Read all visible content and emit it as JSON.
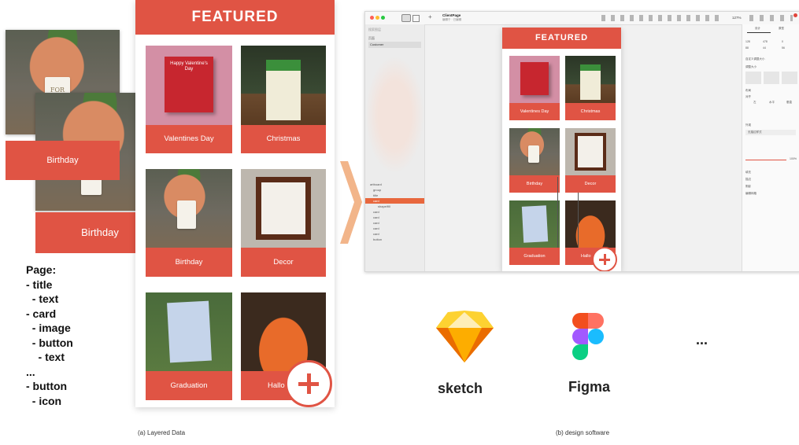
{
  "layered": {
    "featured_title": "FEATURED",
    "cards": [
      {
        "label": "Valentines Day"
      },
      {
        "label": "Christmas"
      },
      {
        "label": "Birthday"
      },
      {
        "label": "Decor"
      },
      {
        "label": "Graduation"
      },
      {
        "label": "Hallo"
      }
    ],
    "card_text_art": {
      "valentine": "Happy Valentine's Day"
    },
    "tag_text": "FOR YOU",
    "exploded_button_label": "Birthday",
    "exploded_card_label": "Birthday",
    "tree": [
      "Page:",
      "- title",
      "  - text",
      "- card",
      "  - image",
      "  - button",
      "    - text",
      "...",
      "- button",
      "  - icon"
    ],
    "caption": "(a) Layered Data"
  },
  "software": {
    "window_title": "ClientPage",
    "window_subtitle": "编辑于 · 已编辑",
    "zoom": "127%",
    "left_panel": {
      "search_placeholder": "搜索图层",
      "page_section": "页面",
      "page_item": "Customer",
      "layers": [
        "artboard",
        "group",
        "title",
        "card",
        "shape/fill",
        "card",
        "card",
        "card",
        "card",
        "card",
        "button"
      ]
    },
    "right_panel": {
      "tabs": [
        "设计",
        "原型"
      ],
      "fields": [
        "128",
        "478",
        "0",
        "88",
        "44",
        "56"
      ],
      "section_labels": [
        "自定义调整大小",
        "调整大小",
        "布局",
        "对齐",
        "外观",
        "填充",
        "描边",
        "阴影",
        "编辑网格"
      ],
      "align_options": [
        "左",
        "水平",
        "垂直"
      ],
      "input_placeholder": "无描边样式",
      "opacity": "100%"
    },
    "featured_title": "FEATURED",
    "cards": [
      {
        "label": "Valentines Day"
      },
      {
        "label": "Christmas"
      },
      {
        "label": "Birthday"
      },
      {
        "label": "Decor"
      },
      {
        "label": "Graduation"
      },
      {
        "label": "Hallo"
      }
    ],
    "caption": "(b) design software",
    "tools": [
      {
        "name": "sketch"
      },
      {
        "name": "Figma"
      },
      {
        "name": "..."
      }
    ]
  },
  "colors": {
    "accent": "#e05444",
    "arrow": "#f2b58a",
    "selection": "#e8673d",
    "sketch_top": "#fdd231",
    "sketch_bottom": "#f7a21b",
    "figma_red": "#f24e1e",
    "figma_orange": "#ff7262",
    "figma_purple": "#a259ff",
    "figma_blue": "#1abcfe",
    "figma_green": "#0acf83"
  }
}
